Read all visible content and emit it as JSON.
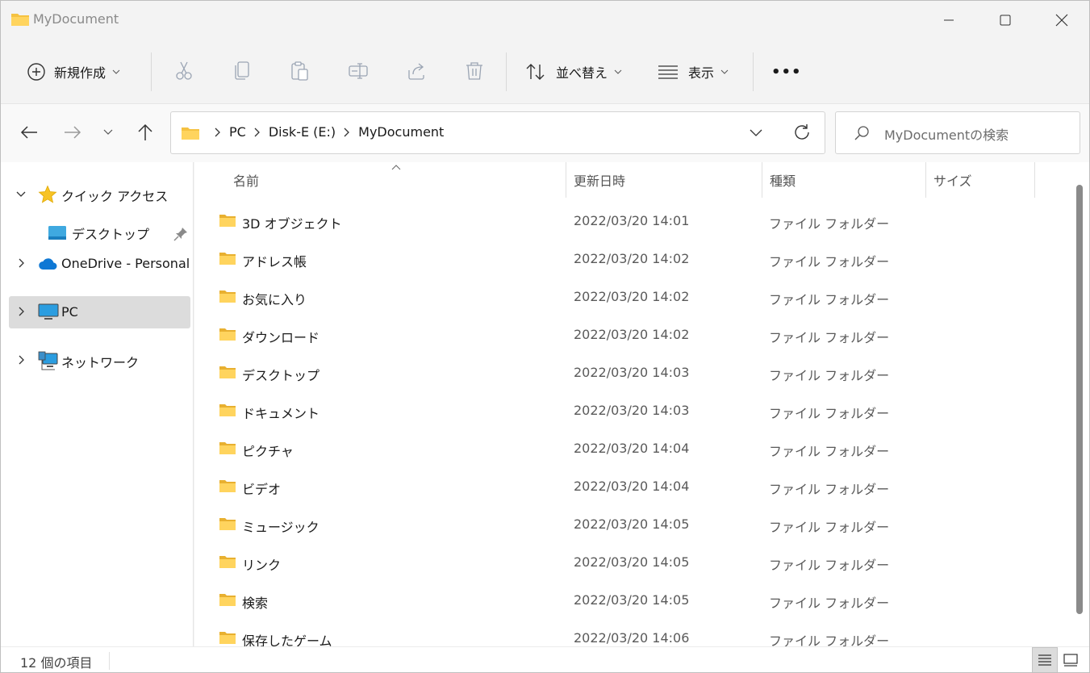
{
  "window": {
    "title": "MyDocument",
    "controls": [
      "minimize",
      "maximize",
      "close"
    ]
  },
  "toolbar": {
    "new_label": "新規作成",
    "sort_label": "並べ替え",
    "view_label": "表示",
    "more_label": "•••",
    "icons": [
      "cut-icon",
      "copy-icon",
      "paste-icon",
      "rename-icon",
      "share-icon",
      "delete-icon"
    ]
  },
  "address": {
    "crumbs": [
      "PC",
      "Disk-E (E:)",
      "MyDocument"
    ]
  },
  "search": {
    "placeholder": "MyDocumentの検索"
  },
  "sidebar": {
    "items": [
      {
        "label": "クイック アクセス",
        "icon": "star-icon"
      },
      {
        "label": "デスクトップ",
        "icon": "desktop-icon"
      },
      {
        "label": "OneDrive - Personal",
        "icon": "onedrive-icon"
      },
      {
        "label": "PC",
        "icon": "pc-icon"
      },
      {
        "label": "ネットワーク",
        "icon": "network-icon"
      }
    ]
  },
  "columns": {
    "name": "名前",
    "date": "更新日時",
    "type": "種類",
    "size": "サイズ"
  },
  "files": [
    {
      "name": "3D オブジェクト",
      "date": "2022/03/20 14:01",
      "type": "ファイル フォルダー"
    },
    {
      "name": "アドレス帳",
      "date": "2022/03/20 14:02",
      "type": "ファイル フォルダー"
    },
    {
      "name": "お気に入り",
      "date": "2022/03/20 14:02",
      "type": "ファイル フォルダー"
    },
    {
      "name": "ダウンロード",
      "date": "2022/03/20 14:02",
      "type": "ファイル フォルダー"
    },
    {
      "name": "デスクトップ",
      "date": "2022/03/20 14:03",
      "type": "ファイル フォルダー"
    },
    {
      "name": "ドキュメント",
      "date": "2022/03/20 14:03",
      "type": "ファイル フォルダー"
    },
    {
      "name": "ピクチャ",
      "date": "2022/03/20 14:04",
      "type": "ファイル フォルダー"
    },
    {
      "name": "ビデオ",
      "date": "2022/03/20 14:04",
      "type": "ファイル フォルダー"
    },
    {
      "name": "ミュージック",
      "date": "2022/03/20 14:05",
      "type": "ファイル フォルダー"
    },
    {
      "name": "リンク",
      "date": "2022/03/20 14:05",
      "type": "ファイル フォルダー"
    },
    {
      "name": "検索",
      "date": "2022/03/20 14:05",
      "type": "ファイル フォルダー"
    },
    {
      "name": "保存したゲーム",
      "date": "2022/03/20 14:06",
      "type": "ファイル フォルダー"
    }
  ],
  "status": {
    "item_count": "12 個の項目"
  },
  "colors": {
    "folder": "#f5c242",
    "selected": "#dcdcdc",
    "accent": "#0067c0"
  }
}
